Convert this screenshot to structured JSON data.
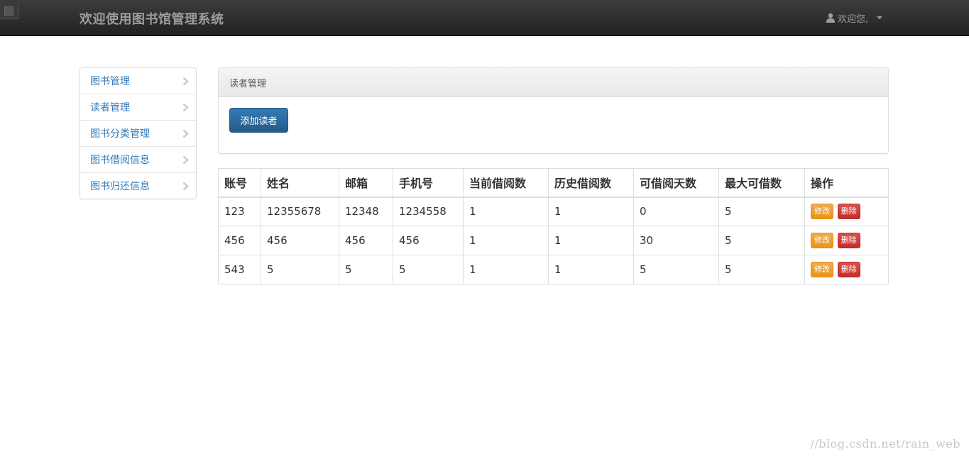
{
  "header": {
    "brand": "欢迎使用图书馆管理系统",
    "user_greeting": "欢迎您,"
  },
  "sidebar": {
    "items": [
      {
        "label": "图书管理"
      },
      {
        "label": "读者管理"
      },
      {
        "label": "图书分类管理"
      },
      {
        "label": "图书借阅信息"
      },
      {
        "label": "图书归还信息"
      }
    ]
  },
  "panel": {
    "title": "读者管理",
    "add_button": "添加读者"
  },
  "table": {
    "columns": [
      "账号",
      "姓名",
      "邮箱",
      "手机号",
      "当前借阅数",
      "历史借阅数",
      "可借阅天数",
      "最大可借数",
      "操作"
    ],
    "rows": [
      [
        "123",
        "12355678",
        "12348",
        "1234558",
        "1",
        "1",
        "0",
        "5"
      ],
      [
        "456",
        "456",
        "456",
        "456",
        "1",
        "1",
        "30",
        "5"
      ],
      [
        "543",
        "5",
        "5",
        "5",
        "1",
        "1",
        "5",
        "5"
      ]
    ],
    "edit_label": "修改",
    "delete_label": "删除"
  },
  "watermark": "//blog.csdn.net/rain_web",
  "colors": {
    "navbar": "#222222",
    "link": "#337ab7",
    "primary": "#265a88",
    "warning": "#f0ad4e",
    "danger": "#d9534f"
  }
}
